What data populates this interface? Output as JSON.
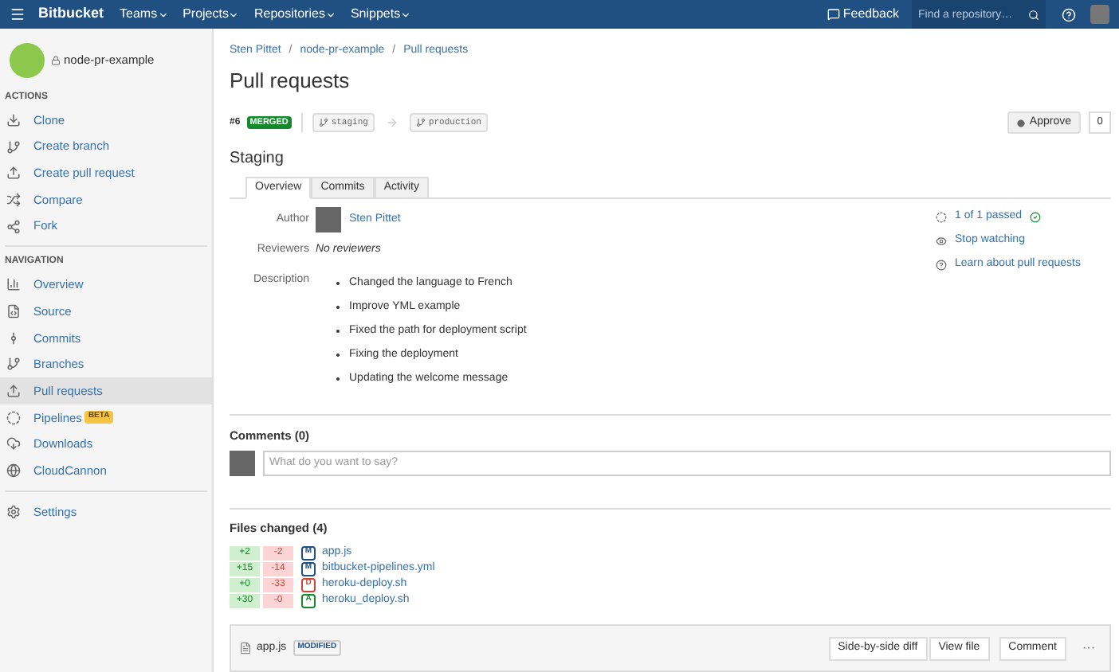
{
  "header": {
    "logo": "Bitbucket",
    "menus": [
      "Teams",
      "Projects",
      "Repositories",
      "Snippets"
    ],
    "feedback": "Feedback",
    "search_placeholder": "Find a repository…"
  },
  "sidebar": {
    "repo": "node-pr-example",
    "sections": [
      {
        "title": "ACTIONS",
        "items": [
          {
            "label": "Clone",
            "selected": false
          },
          {
            "label": "Create branch",
            "selected": false
          },
          {
            "label": "Create pull request",
            "selected": false
          },
          {
            "label": "Compare",
            "selected": false
          },
          {
            "label": "Fork",
            "selected": false
          }
        ]
      },
      {
        "title": "NAVIGATION",
        "items": [
          {
            "label": "Overview",
            "selected": false
          },
          {
            "label": "Source",
            "selected": false
          },
          {
            "label": "Commits",
            "selected": false
          },
          {
            "label": "Branches",
            "selected": false
          },
          {
            "label": "Pull requests",
            "selected": true
          },
          {
            "label": "Pipelines",
            "selected": false,
            "badge": "BETA"
          },
          {
            "label": "Downloads",
            "selected": false
          },
          {
            "label": "CloudCannon",
            "selected": false
          }
        ]
      }
    ],
    "settings": "Settings"
  },
  "breadcrumbs": [
    {
      "kind": "link",
      "text": "Sten Pittet"
    },
    {
      "kind": "separator",
      "text": "/"
    },
    {
      "kind": "link",
      "text": "node-pr-example"
    },
    {
      "kind": "separator",
      "text": "/"
    },
    {
      "kind": "link",
      "text": "Pull requests"
    }
  ],
  "title": "Pull requests",
  "pr": {
    "number": "#6",
    "status": "MERGED",
    "source": "staging",
    "target": "production",
    "approve": "Approve",
    "approve_count": "0",
    "title": "Staging"
  },
  "tabs": [
    {
      "label": "Overview",
      "selected": true
    },
    {
      "label": "Commits",
      "selected": false
    },
    {
      "label": "Activity",
      "selected": false
    }
  ],
  "details": {
    "author_label": "Author",
    "author": "Sten Pittet",
    "reviewers_label": "Reviewers",
    "reviewers": "No reviewers",
    "description_label": "Description",
    "description": [
      "Changed the language to French",
      "Improve YML example",
      "Fixed the path for deployment script",
      "Fixing the deployment",
      "Updating the welcome message"
    ]
  },
  "side_links": [
    "1 of 1 passed",
    "Stop watching",
    "Learn about pull requests"
  ],
  "comments": {
    "title": "Comments (0)",
    "placeholder": "What do you want to say?"
  },
  "files": {
    "title": "Files changed (4)",
    "items": [
      {
        "added": "+2",
        "removed": "-2",
        "change": "M",
        "color": "#205081",
        "name": "app.js"
      },
      {
        "added": "+15",
        "removed": "-14",
        "change": "M",
        "color": "#205081",
        "name": "bitbucket-pipelines.yml"
      },
      {
        "added": "+0",
        "removed": "-33",
        "change": "D",
        "color": "#d04437",
        "name": "heroku-deploy.sh"
      },
      {
        "added": "+30",
        "removed": "-0",
        "change": "A",
        "color": "#14892c",
        "name": "heroku_deploy.sh"
      }
    ]
  },
  "file_header": {
    "name": "app.js",
    "badge": "MODIFIED",
    "buttons": [
      "Side-by-side diff",
      "View file",
      "Comment"
    ],
    "more": "···"
  }
}
